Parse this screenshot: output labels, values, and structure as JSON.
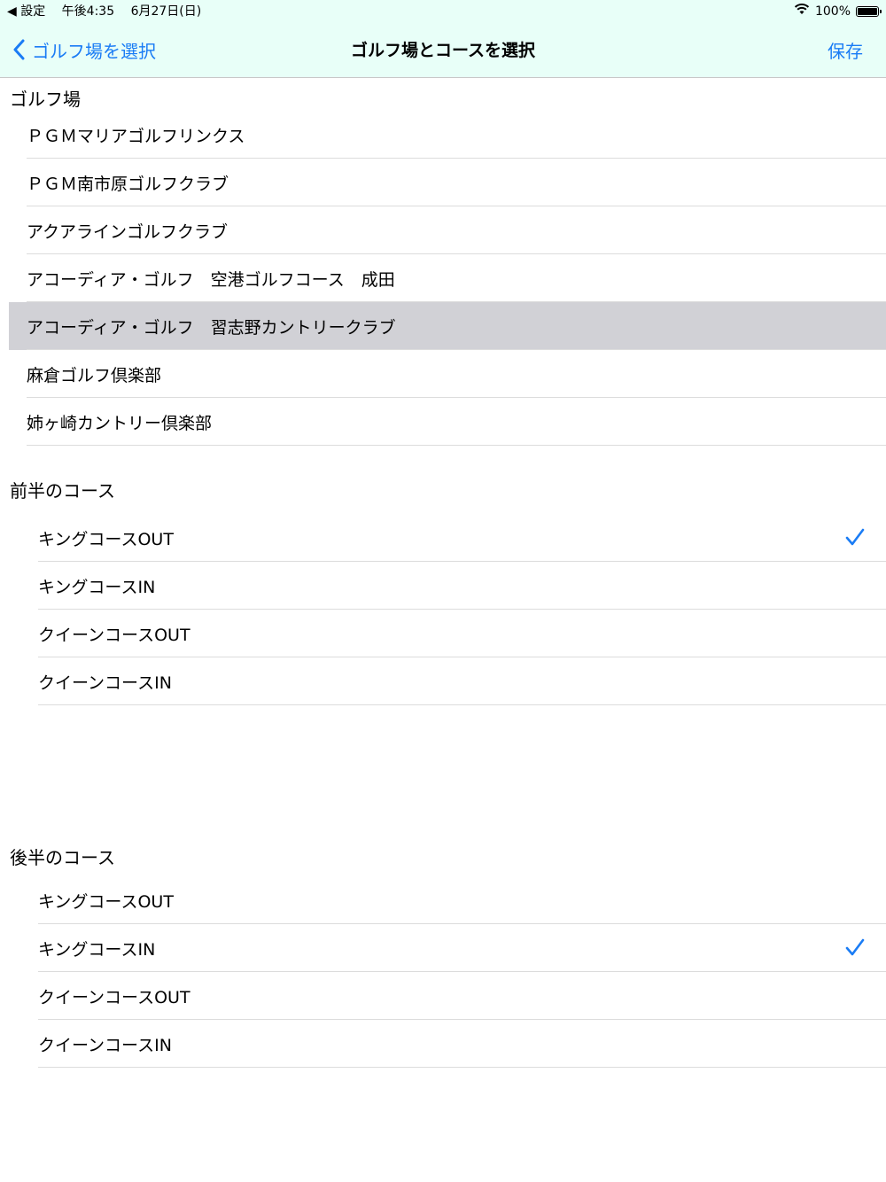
{
  "status_bar": {
    "back_app": "◀ 設定",
    "time": "午後4:35",
    "date": "6月27日(日)",
    "battery": "100%",
    "battery_level": 1.0
  },
  "nav": {
    "back_label": "ゴルフ場を選択",
    "title": "ゴルフ場とコースを選択",
    "save_label": "保存"
  },
  "accent_color": "#1a7cf5",
  "golf_section": {
    "header": "ゴルフ場",
    "items": [
      {
        "label": "ＰＧＭマリアゴルフリンクス",
        "selected": false
      },
      {
        "label": "ＰＧＭ南市原ゴルフクラブ",
        "selected": false
      },
      {
        "label": "アクアラインゴルフクラブ",
        "selected": false
      },
      {
        "label": "アコーディア・ゴルフ　空港ゴルフコース　成田",
        "selected": false
      },
      {
        "label": "アコーディア・ゴルフ　習志野カントリークラブ",
        "selected": true
      },
      {
        "label": "麻倉ゴルフ倶楽部",
        "selected": false
      },
      {
        "label": "姉ヶ崎カントリー倶楽部",
        "selected": false
      }
    ]
  },
  "first_half": {
    "header": "前半のコース",
    "items": [
      {
        "label": "キングコースOUT",
        "checked": true
      },
      {
        "label": "キングコースIN",
        "checked": false
      },
      {
        "label": "クイーンコースOUT",
        "checked": false
      },
      {
        "label": "クイーンコースIN",
        "checked": false
      }
    ]
  },
  "second_half": {
    "header": "後半のコース",
    "items": [
      {
        "label": "キングコースOUT",
        "checked": false
      },
      {
        "label": "キングコースIN",
        "checked": true
      },
      {
        "label": "クイーンコースOUT",
        "checked": false
      },
      {
        "label": "クイーンコースIN",
        "checked": false
      }
    ]
  }
}
